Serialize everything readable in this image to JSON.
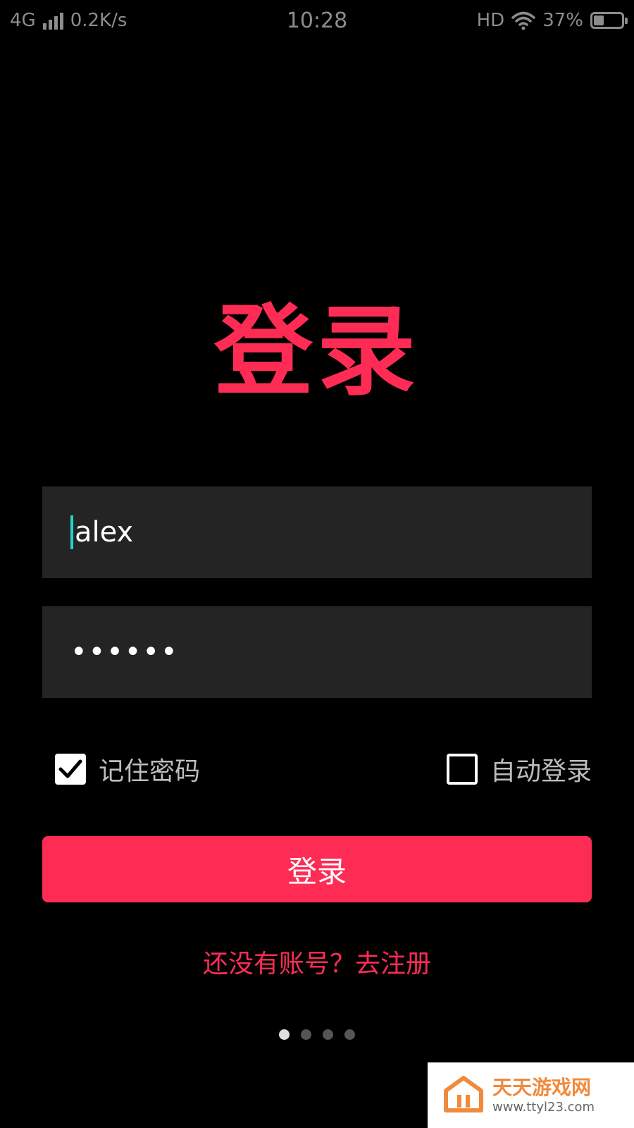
{
  "colors": {
    "accent": "#fe2c55",
    "background": "#000000",
    "input_background": "#242424",
    "caret": "#20d5c8",
    "dot_active": "#e0e0e0",
    "dot_inactive": "#555555",
    "watermark_orange": "#f08a3c"
  },
  "status_bar": {
    "network": "4G",
    "speed": "0.2K/s",
    "time": "10:28",
    "hd": "HD",
    "battery": "37%",
    "battery_level": 0.37,
    "icons": [
      "signal-icon",
      "wifi-icon",
      "battery-icon"
    ]
  },
  "title": "登录",
  "username": {
    "value": "alex"
  },
  "password": {
    "masked_value": "••••••"
  },
  "options": {
    "remember_password": {
      "label": "记住密码",
      "checked": true
    },
    "auto_login": {
      "label": "自动登录",
      "checked": false
    }
  },
  "login_button": {
    "label": "登录"
  },
  "register_link": {
    "label": "还没有账号？去注册"
  },
  "page_indicator": {
    "count": 4,
    "active_index": 0
  },
  "watermark": {
    "name": "天天游戏网",
    "url": "www.ttyl23.com"
  }
}
